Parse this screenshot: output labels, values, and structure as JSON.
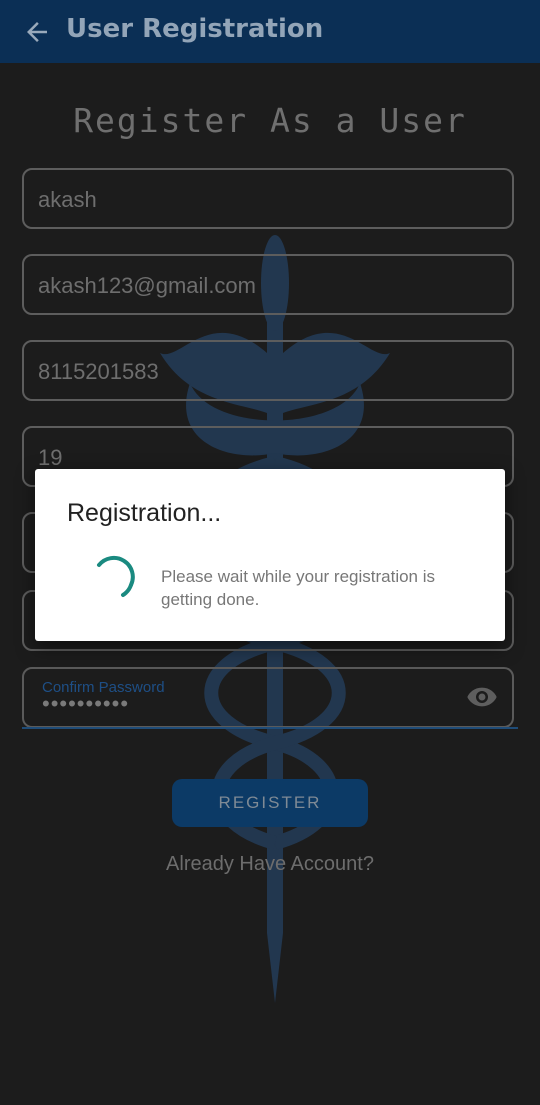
{
  "app_bar": {
    "title": "User Registration",
    "back_icon": "arrow-left-icon"
  },
  "form": {
    "heading": "Register As a User",
    "fields": [
      {
        "value": "akash"
      },
      {
        "value": "akash123@gmail.com"
      },
      {
        "value": "8115201583"
      },
      {
        "value": "19"
      }
    ],
    "confirm_password": {
      "label": "Confirm Password",
      "masked_value": "••••••••••"
    },
    "register_button": "REGISTER",
    "account_link": "Already Have Account?"
  },
  "dialog": {
    "title": "Registration...",
    "message": "Please wait while your registration is getting done."
  },
  "colors": {
    "app_bar": "#0b2f55",
    "background": "#1c1c1c",
    "spinner": "#1a8a80",
    "dialog": "#ffffff"
  }
}
